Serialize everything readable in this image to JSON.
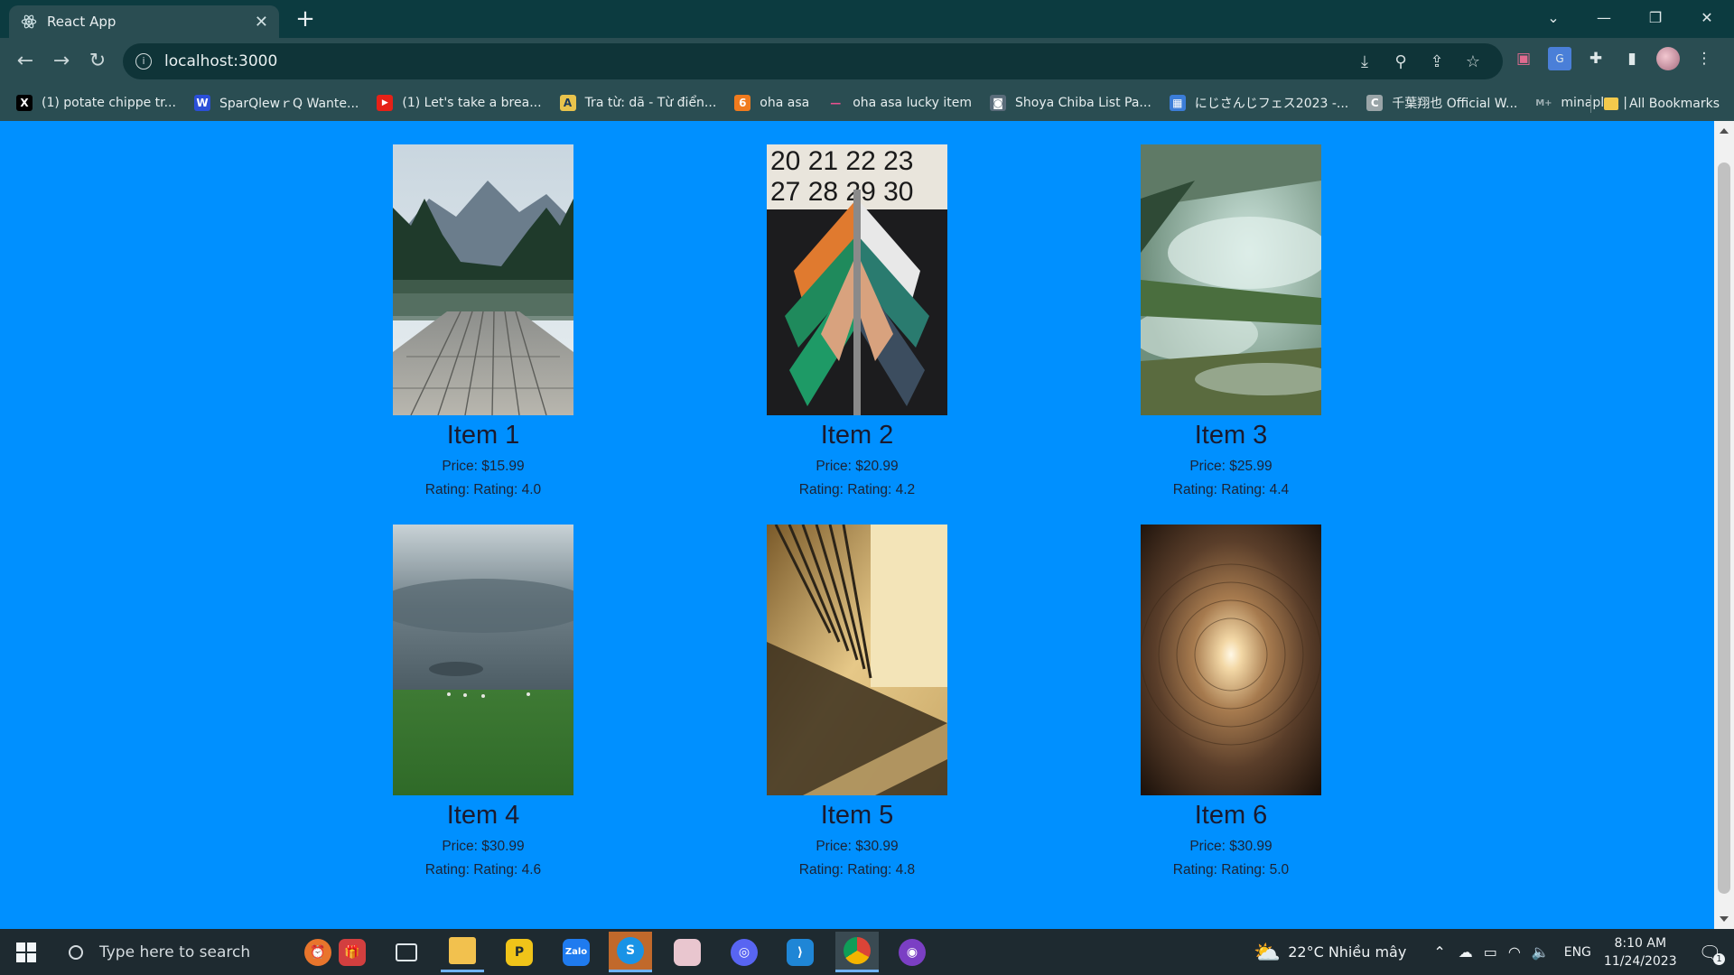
{
  "browser": {
    "tab_title": "React App",
    "url": "localhost:3000",
    "bookmarks": [
      {
        "label": "(1) potate chippe tr...",
        "icon": "x-icon",
        "color": "#000000",
        "glyph": "X"
      },
      {
        "label": "SparQlewｒQ Wante...",
        "icon": "w-icon",
        "color": "#2b4fd8",
        "glyph": "W"
      },
      {
        "label": "(1) Let's take a brea...",
        "icon": "youtube-icon",
        "color": "#e62117",
        "glyph": "▶"
      },
      {
        "label": "Tra từ: dã - Từ điển...",
        "icon": "dictionary-icon",
        "color": "#e8c34c",
        "glyph": "A"
      },
      {
        "label": "oha asa",
        "icon": "channel-6-icon",
        "color": "#f07b1e",
        "glyph": "6"
      },
      {
        "label": "oha asa lucky item",
        "icon": "pink-pen-icon",
        "color": "#e8508f",
        "glyph": "—"
      },
      {
        "label": "Shoya Chiba List Pa...",
        "icon": "image-icon",
        "color": "#5a6c7a",
        "glyph": "◙"
      },
      {
        "label": "にじさんじフェス2023 -...",
        "icon": "calendar-icon",
        "color": "#3b7dd8",
        "glyph": "▦"
      },
      {
        "label": "千葉翔也 Official W...",
        "icon": "c-icon",
        "color": "#9aa5a8",
        "glyph": "C"
      },
      {
        "label": "minaplex |",
        "icon": "m-plus-icon",
        "color": "#6b7b80",
        "glyph": "M+"
      }
    ],
    "all_bookmarks_label": "All Bookmarks"
  },
  "products": [
    {
      "name": "Item 1",
      "price": "Price: $15.99",
      "rating": "Rating: Rating: 4.0",
      "image": "mountain-lake-dock"
    },
    {
      "name": "Item 2",
      "price": "Price: $20.99",
      "rating": "Rating: Rating: 4.2",
      "image": "clothes-rack"
    },
    {
      "name": "Item 3",
      "price": "Price: $25.99",
      "rating": "Rating: Rating: 4.4",
      "image": "misty-hills"
    },
    {
      "name": "Item 4",
      "price": "Price: $30.99",
      "rating": "Rating: Rating: 4.6",
      "image": "stormy-field"
    },
    {
      "name": "Item 5",
      "price": "Price: $30.99",
      "rating": "Rating: Rating: 4.8",
      "image": "wooden-slats"
    },
    {
      "name": "Item 6",
      "price": "Price: $30.99",
      "rating": "Rating: Rating: 5.0",
      "image": "light-tunnel"
    }
  ],
  "taskbar": {
    "search_placeholder": "Type here to search",
    "weather": "22°C  Nhiều mây",
    "language": "ENG",
    "time": "8:10 AM",
    "date": "11/24/2023",
    "notification_count": "1"
  },
  "colors": {
    "page_background": "#0090ff",
    "chrome_frame": "#0c3b40",
    "chrome_toolbar": "#2a4d52"
  }
}
